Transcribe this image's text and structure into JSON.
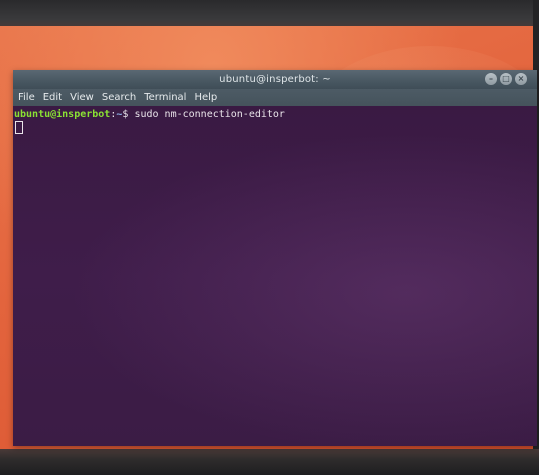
{
  "window": {
    "title": "ubuntu@insperbot: ~",
    "buttons": {
      "minimize": "–",
      "maximize": "□",
      "close": "×"
    }
  },
  "menu": {
    "items": [
      "File",
      "Edit",
      "View",
      "Search",
      "Terminal",
      "Help"
    ]
  },
  "terminal": {
    "prompt_userhost": "ubuntu@insperbot",
    "prompt_sep": ":",
    "prompt_path": "~",
    "prompt_symbol": "$",
    "command": " sudo nm-connection-editor"
  },
  "colors": {
    "desktop": "#e3643d",
    "terminal_bg": "#3f1d4a",
    "titlebar": "#485761",
    "prompt_green": "#8ae234",
    "prompt_blue": "#8fb2e8"
  }
}
